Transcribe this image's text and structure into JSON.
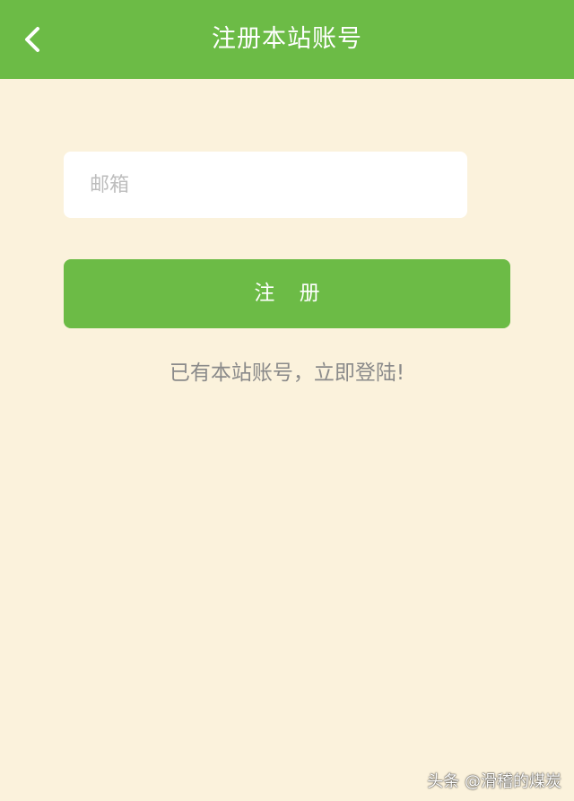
{
  "header": {
    "title": "注册本站账号",
    "back_icon": "chevron-left-icon",
    "color": "#6cbb46"
  },
  "form": {
    "email": {
      "placeholder": "邮箱",
      "value": ""
    },
    "register_label": "注 册",
    "login_link": "已有本站账号，立即登陆!"
  },
  "watermark": {
    "text": "头条 @滑稽的煤炭"
  },
  "colors": {
    "primary": "#6cbb46",
    "background": "#fbf2dc",
    "input_background": "#ffffff",
    "muted_text": "#8a8a8a",
    "placeholder": "#bdbdbd"
  }
}
